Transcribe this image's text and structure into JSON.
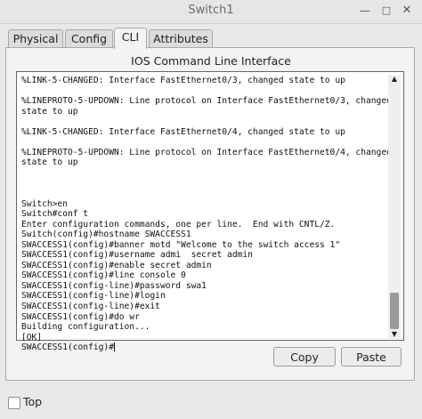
{
  "window": {
    "title": "Switch1",
    "minimize_glyph": "—",
    "maximize_glyph": "□",
    "close_glyph": "✕"
  },
  "tabs": [
    {
      "label": "Physical",
      "active": false
    },
    {
      "label": "Config",
      "active": false
    },
    {
      "label": "CLI",
      "active": true
    },
    {
      "label": "Attributes",
      "active": false
    }
  ],
  "panel": {
    "title": "IOS Command Line Interface"
  },
  "console": {
    "text": "%LINK-5-CHANGED: Interface FastEthernet0/3, changed state to up\n\n%LINEPROTO-5-UPDOWN: Line protocol on Interface FastEthernet0/3, changed\nstate to up\n\n%LINK-5-CHANGED: Interface FastEthernet0/4, changed state to up\n\n%LINEPROTO-5-UPDOWN: Line protocol on Interface FastEthernet0/4, changed\nstate to up\n\n\n\nSwitch>en\nSwitch#conf t\nEnter configuration commands, one per line.  End with CNTL/Z.\nSwitch(config)#hostname SWACCESS1\nSWACCESS1(config)#banner motd \"Welcome to the switch access 1\"\nSWACCESS1(config)#username admi  secret admin\nSWACCESS1(config)#enable secret admin\nSWACCESS1(config)#line console 0\nSWACCESS1(config-line)#password swa1\nSWACCESS1(config-line)#login\nSWACCESS1(config-line)#exit\nSWACCESS1(config)#do wr\nBuilding configuration...\n[OK]\nSWACCESS1(config)#",
    "scroll_up_icon": "▲",
    "scroll_down_icon": "▼"
  },
  "buttons": {
    "copy": "Copy",
    "paste": "Paste"
  },
  "footer": {
    "top_label": "Top",
    "top_checked": false
  }
}
